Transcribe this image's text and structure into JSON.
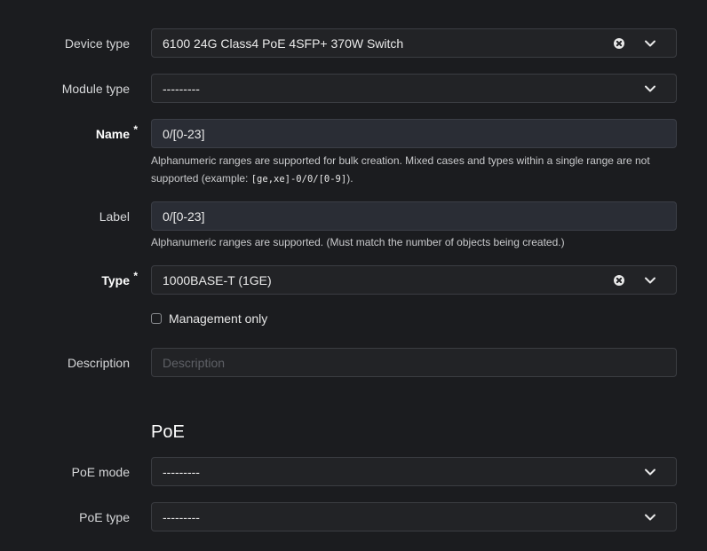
{
  "device_type": {
    "label": "Device type",
    "value": "6100 24G Class4 PoE 4SFP+ 370W Switch"
  },
  "module_type": {
    "label": "Module type",
    "value": "---------"
  },
  "name": {
    "label": "Name",
    "required_marker": "*",
    "value": "0/[0-23]",
    "help_part1": "Alphanumeric ranges are supported for bulk creation. Mixed cases and types within a single range are not supported (example: ",
    "help_code1": "[ge,xe]-0/0/[0-9]",
    "help_part2": ")."
  },
  "label_field": {
    "label": "Label",
    "value": "0/[0-23]",
    "help": "Alphanumeric ranges are supported. (Must match the number of objects being created.)"
  },
  "type": {
    "label": "Type",
    "required_marker": "*",
    "value": "1000BASE-T (1GE)"
  },
  "management_only": {
    "label": "Management only",
    "checked": false
  },
  "description": {
    "label": "Description",
    "placeholder": "Description"
  },
  "poe_section": {
    "title": "PoE"
  },
  "poe_mode": {
    "label": "PoE mode",
    "value": "---------"
  },
  "poe_type": {
    "label": "PoE type",
    "value": "---------"
  },
  "colors": {
    "background": "#1b1c1f",
    "field_background": "#222326",
    "text_field_background": "#2a2d35",
    "border": "#3b3d42"
  }
}
